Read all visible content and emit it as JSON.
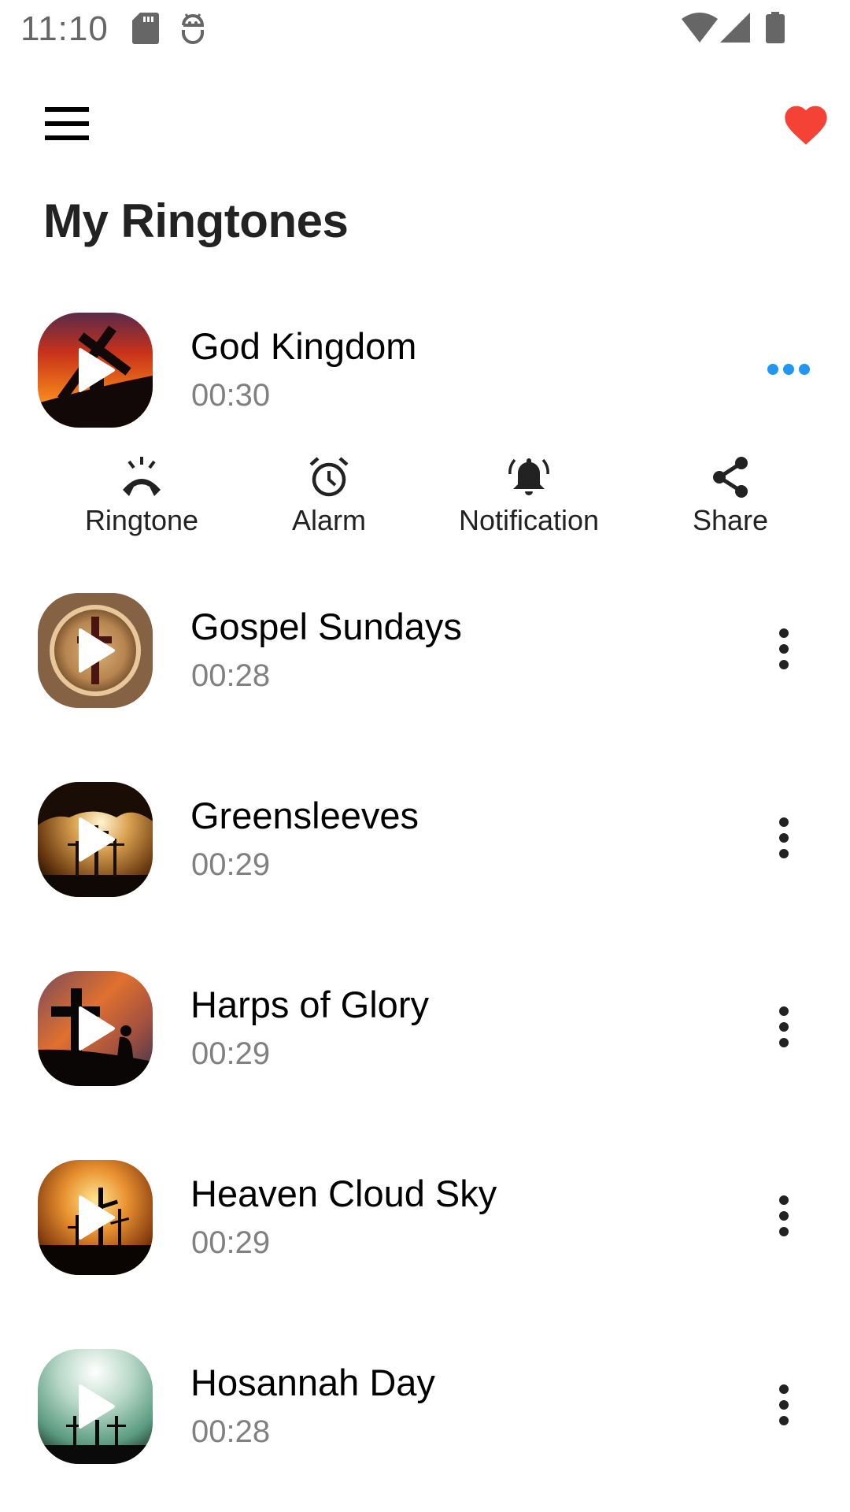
{
  "status_bar": {
    "time": "11:10",
    "left_icons": [
      "sd-card-icon",
      "debug-bug-icon"
    ],
    "right_icons": [
      "wifi-icon",
      "cell-signal-icon",
      "battery-icon"
    ]
  },
  "top_bar": {
    "menu_icon": "hamburger-menu-icon",
    "favorite_icon": "heart-icon",
    "favorite_color": "#f44336"
  },
  "page": {
    "title": "My Ringtones"
  },
  "accent_color": "#2196f3",
  "ringtones": [
    {
      "title": "God Kingdom",
      "duration": "00:30",
      "expanded": true,
      "thumb": "cross-sunset-red"
    },
    {
      "title": "Gospel Sundays",
      "duration": "00:28",
      "expanded": false,
      "thumb": "coffee-cross"
    },
    {
      "title": "Greensleeves",
      "duration": "00:29",
      "expanded": false,
      "thumb": "three-crosses-cave"
    },
    {
      "title": "Harps of Glory",
      "duration": "00:29",
      "expanded": false,
      "thumb": "cross-kneeling-sunset"
    },
    {
      "title": "Heaven Cloud Sky",
      "duration": "00:29",
      "expanded": false,
      "thumb": "three-crosses-golden-sky"
    },
    {
      "title": "Hosannah Day",
      "duration": "00:28",
      "expanded": false,
      "thumb": "three-crosses-green-sky"
    }
  ],
  "actions": [
    {
      "label": "Ringtone",
      "icon": "phone-ringing-icon"
    },
    {
      "label": "Alarm",
      "icon": "alarm-clock-icon"
    },
    {
      "label": "Notification",
      "icon": "bell-ringing-icon"
    },
    {
      "label": "Share",
      "icon": "share-icon"
    }
  ]
}
